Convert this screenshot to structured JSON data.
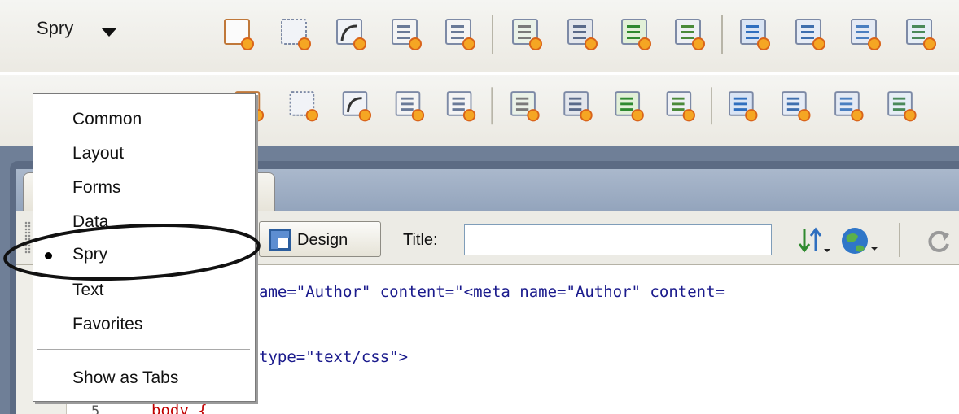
{
  "insert_bar": {
    "category_label": "Spry",
    "row1_icons": [
      "spry-xml-dataset-icon",
      "spry-region-icon",
      "spry-repeat-icon",
      "spry-repeat-list-icon",
      "spry-table-icon",
      "spry-validation-text-field-icon",
      "spry-validation-select-icon",
      "spry-validation-checkbox-icon",
      "spry-validation-textarea-icon",
      "spry-menu-bar-icon",
      "spry-tabbed-panels-icon",
      "spry-accordion-icon",
      "spry-collapsible-panel-icon"
    ],
    "row2_icons": [
      "spry-xml-dataset-icon",
      "spry-region-icon",
      "spry-repeat-icon",
      "spry-repeat-list-icon",
      "spry-table-icon",
      "spry-validation-text-field-icon",
      "spry-validation-select-icon",
      "spry-validation-checkbox-icon",
      "spry-validation-textarea-icon",
      "spry-menu-bar-icon",
      "spry-tabbed-panels-icon",
      "spry-accordion-icon",
      "spry-collapsible-panel-icon"
    ]
  },
  "category_menu": {
    "items": [
      "Common",
      "Layout",
      "Forms",
      "Data",
      "Spry",
      "Text",
      "Favorites"
    ],
    "selected": "Spry",
    "show_as_tabs": "Show as Tabs"
  },
  "doc_toolbar": {
    "design_label": "Design",
    "title_label": "Title:",
    "title_value": ""
  },
  "code": {
    "lines": [
      {
        "num": "",
        "text": "ame=\"Author\" content=\"<meta name=\"Author\" content="
      },
      {
        "num": "",
        "text": "type=\"text/css\">"
      },
      {
        "num": "5",
        "text": "body {"
      }
    ]
  }
}
